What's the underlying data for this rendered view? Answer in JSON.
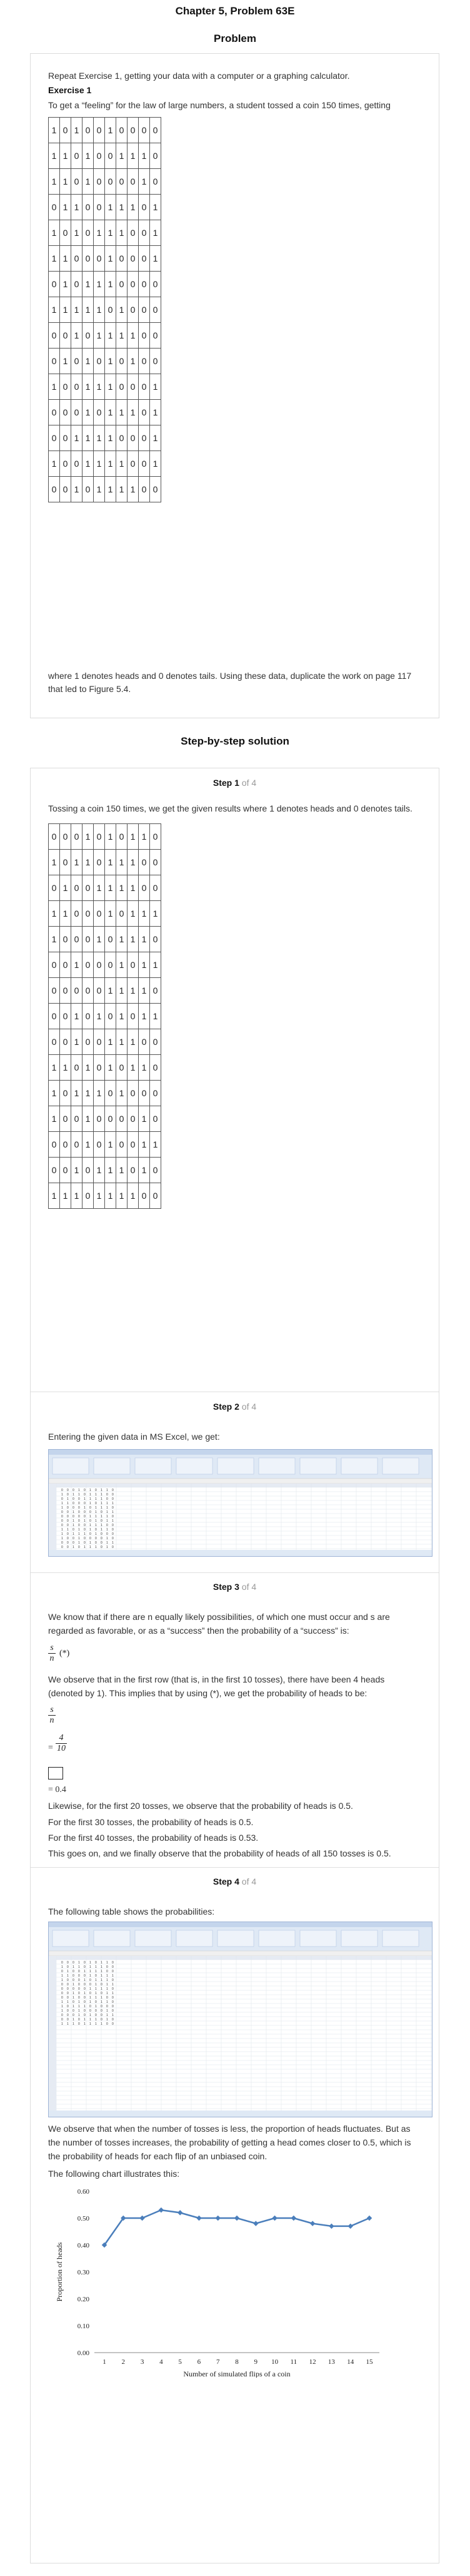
{
  "header": {
    "chapter": "Chapter 5, Problem 63E",
    "problem": "Problem"
  },
  "problem": {
    "intro": "Repeat Exercise 1, getting your data with a computer or a graphing calculator.",
    "exercise_title": "Exercise 1",
    "exercise_text": "To get a “feeling” for the law of large numbers, a student tossed a coin 150 times, getting",
    "grid": [
      [
        1,
        0,
        1,
        0,
        0,
        1,
        0,
        0,
        0,
        0
      ],
      [
        1,
        1,
        0,
        1,
        0,
        0,
        1,
        1,
        1,
        0
      ],
      [
        1,
        1,
        0,
        1,
        0,
        0,
        0,
        0,
        1,
        0
      ],
      [
        0,
        1,
        1,
        0,
        0,
        1,
        1,
        1,
        0,
        1
      ],
      [
        1,
        0,
        1,
        0,
        1,
        1,
        1,
        0,
        0,
        1
      ],
      [
        1,
        1,
        0,
        0,
        0,
        1,
        0,
        0,
        0,
        1
      ],
      [
        0,
        1,
        0,
        1,
        1,
        1,
        0,
        0,
        0,
        0
      ],
      [
        1,
        1,
        1,
        1,
        1,
        0,
        1,
        0,
        0,
        0
      ],
      [
        0,
        0,
        1,
        0,
        1,
        1,
        1,
        1,
        0,
        0
      ],
      [
        0,
        1,
        0,
        1,
        0,
        1,
        0,
        1,
        0,
        0
      ],
      [
        1,
        0,
        0,
        1,
        1,
        1,
        0,
        0,
        0,
        1
      ],
      [
        0,
        0,
        0,
        1,
        0,
        1,
        1,
        1,
        0,
        1
      ],
      [
        0,
        0,
        1,
        1,
        1,
        1,
        0,
        0,
        0,
        1
      ],
      [
        1,
        0,
        0,
        1,
        1,
        1,
        1,
        0,
        0,
        1
      ],
      [
        0,
        0,
        1,
        0,
        1,
        1,
        1,
        1,
        0,
        0
      ]
    ],
    "closing_1": "where 1 denotes heads and 0 denotes tails. Using these data, duplicate the work on page 117",
    "closing_2": "that led to Figure 5.4."
  },
  "solution": {
    "title": "Step-by-step solution",
    "step_word": "Step",
    "of_text": "of 4",
    "steps": [
      {
        "num": "1",
        "text": "Tossing a coin 150 times, we get the given results where 1 denotes heads and 0 denotes tails.",
        "grid": [
          [
            0,
            0,
            0,
            1,
            0,
            1,
            0,
            1,
            1,
            0
          ],
          [
            1,
            0,
            1,
            1,
            0,
            1,
            1,
            1,
            0,
            0
          ],
          [
            0,
            1,
            0,
            0,
            1,
            1,
            1,
            1,
            0,
            0
          ],
          [
            1,
            1,
            0,
            0,
            0,
            1,
            0,
            1,
            1,
            1
          ],
          [
            1,
            0,
            0,
            0,
            1,
            0,
            1,
            1,
            1,
            0
          ],
          [
            0,
            0,
            1,
            0,
            0,
            0,
            1,
            0,
            1,
            1
          ],
          [
            0,
            0,
            0,
            0,
            0,
            1,
            1,
            1,
            1,
            0
          ],
          [
            0,
            0,
            1,
            0,
            1,
            0,
            1,
            0,
            1,
            1
          ],
          [
            0,
            0,
            1,
            0,
            0,
            1,
            1,
            1,
            0,
            0
          ],
          [
            1,
            1,
            0,
            1,
            0,
            1,
            0,
            1,
            1,
            0
          ],
          [
            1,
            0,
            1,
            1,
            1,
            0,
            1,
            0,
            0,
            0
          ],
          [
            1,
            0,
            0,
            1,
            0,
            0,
            0,
            0,
            1,
            0
          ],
          [
            0,
            0,
            0,
            1,
            0,
            1,
            0,
            0,
            1,
            1
          ],
          [
            0,
            0,
            1,
            0,
            1,
            1,
            1,
            0,
            1,
            0
          ],
          [
            1,
            1,
            1,
            0,
            1,
            1,
            1,
            1,
            0,
            0
          ]
        ]
      },
      {
        "num": "2",
        "text": "Entering the given data in MS Excel, we get:"
      },
      {
        "num": "3",
        "p1a": "We know that if there are n equally likely possibilities, of which one must occur and s are",
        "p1b": "regarded as favorable, or as a “success” then the probability of a “success” is:",
        "frac_top": "s",
        "frac_bot": "n",
        "frac_ref": "(*)",
        "p2a": "We observe that in the first row (that is, in the first 10 tosses), there have been 4 heads",
        "p2b": "(denoted by 1). This implies that by using (*), we get the probability of heads to be:",
        "frac2_top": "s",
        "frac2_bot": "n",
        "eq_sign": "=",
        "frac3_top": "4",
        "frac3_bot": "10",
        "result": "= 0.4",
        "p3": "Likewise, for the first 20 tosses, we observe that the probability of heads is 0.5.",
        "p4": "For the first 30 tosses, the probability of heads is 0.5.",
        "p5": "For the first 40 tosses, the probability of heads is 0.53.",
        "p6": "This goes on, and we finally observe that the probability of heads of all 150 tosses is 0.5."
      },
      {
        "num": "4",
        "text": "The following table shows the probabilities:",
        "p2a": "We observe that when the number of tosses is less, the proportion of heads fluctuates. But as",
        "p2b": "the number of tosses increases, the probability of getting a head comes closer to 0.5, which is",
        "p2c": "the probability of heads for each flip of an unbiased coin.",
        "p3": "The following chart illustrates this:"
      }
    ]
  },
  "chart_data": {
    "type": "line",
    "x": [
      1,
      2,
      3,
      4,
      5,
      6,
      7,
      8,
      9,
      10,
      11,
      12,
      13,
      14,
      15
    ],
    "series": [
      {
        "values": [
          0.4,
          0.5,
          0.5,
          0.53,
          0.52,
          0.5,
          0.5,
          0.5,
          0.48,
          0.5,
          0.5,
          0.48,
          0.47,
          0.47,
          0.5
        ]
      }
    ],
    "xlabel": "Number of simulated flips of a coin",
    "ylabel": "Proportion of heads",
    "ylim": [
      0,
      0.6
    ],
    "yticks": [
      "0.00",
      "0.10",
      "0.20",
      "0.30",
      "0.40",
      "0.50",
      "0.60"
    ],
    "xticks": [
      "1",
      "2",
      "3",
      "4",
      "5",
      "6",
      "7",
      "8",
      "9",
      "10",
      "11",
      "12",
      "13",
      "14",
      "15"
    ],
    "color": "#4a7ebb",
    "grid": false
  }
}
